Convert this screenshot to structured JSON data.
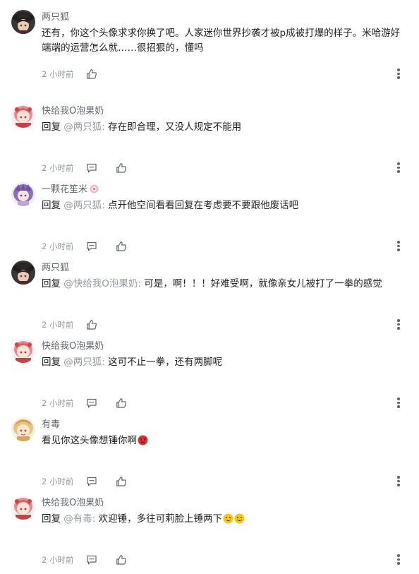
{
  "comments": [
    {
      "avatar": "hat-girl-avatar",
      "username": "两只狐",
      "reply_prefix": "",
      "mention": "",
      "text": "还有，你这个头像求求你换了吧。人家迷你世界抄袭才被p成被打爆的样子。米哈游好端端的运营怎么就……很招狠的，懂吗",
      "time": "2 小时前",
      "show_reply_icon": false
    },
    {
      "avatar": "pink-hair-girl-avatar",
      "username": "快给我O泡果奶",
      "reply_prefix": "回复",
      "mention": "@两只狐:",
      "text": "存在即合理，又没人规定不能用",
      "time": "2 小时前",
      "show_reply_icon": true
    },
    {
      "avatar": "purple-hair-girl-avatar",
      "username": "一颗花笙米",
      "badge": "flower-badge-icon",
      "reply_prefix": "回复",
      "mention": "@两只狐:",
      "text": "点开他空间看看回复在考虑要不要跟他废话吧",
      "time": "2 小时前",
      "show_reply_icon": true
    },
    {
      "avatar": "hat-girl-avatar",
      "username": "两只狐",
      "reply_prefix": "回复",
      "mention": "@快给我O泡果奶:",
      "text": "可是，啊！！！好难受啊，就像亲女儿被打了一拳的感觉",
      "time": "2 小时前",
      "show_reply_icon": false
    },
    {
      "avatar": "pink-hair-girl-avatar",
      "username": "快给我O泡果奶",
      "reply_prefix": "回复",
      "mention": "@两只狐:",
      "text": "这可不止一拳，还有两脚呢",
      "time": "2 小时前",
      "show_reply_icon": true
    },
    {
      "avatar": "blonde-girl-avatar",
      "username": "有毒",
      "reply_prefix": "",
      "mention": "",
      "text": "看见你这头像想锤你啊",
      "emojis": [
        "angry-face-emoji"
      ],
      "time": "2 小时前",
      "show_reply_icon": true
    },
    {
      "avatar": "pink-hair-girl-avatar",
      "username": "快给我O泡果奶",
      "reply_prefix": "回复",
      "mention": "@有毒:",
      "text": "欢迎锤，多往可莉脸上锤两下",
      "emojis": [
        "grinning-face-emoji",
        "grinning-face-emoji"
      ],
      "time": "2 小时前",
      "show_reply_icon": true
    }
  ],
  "colors": {
    "username": "#61666d",
    "mention": "#9499a0",
    "meta": "#9499a0",
    "text": "#222222",
    "emoji_yellow": "#f5c518",
    "emoji_angry": "#e0303a"
  }
}
